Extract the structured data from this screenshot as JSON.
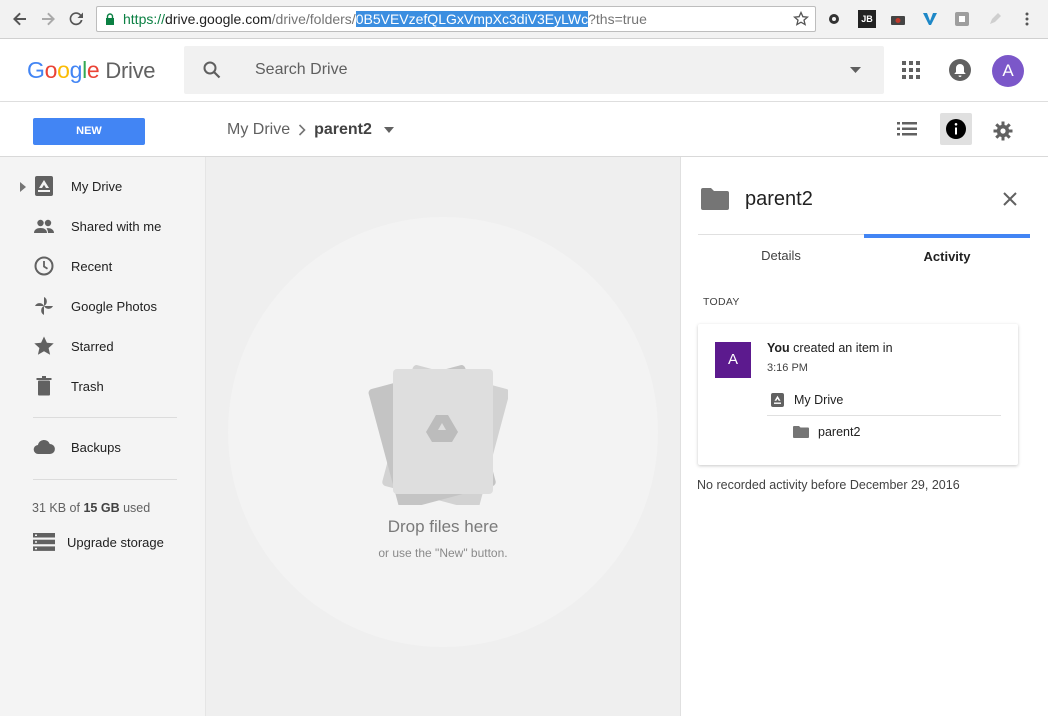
{
  "browser": {
    "url_scheme": "https://",
    "url_host": "drive.google.com",
    "url_path": "/drive/folders/",
    "url_selected": "0B5VEVzefQLGxVmpXc3diV3EyLWc",
    "url_query": "?ths=true"
  },
  "header": {
    "logo_google": "Google",
    "logo_drive": "Drive",
    "search_placeholder": "Search Drive",
    "avatar_letter": "A"
  },
  "toolbar": {
    "new_label": "NEW",
    "breadcrumb_root": "My Drive",
    "breadcrumb_current": "parent2"
  },
  "sidebar": {
    "items": [
      {
        "label": "My Drive",
        "icon": "drive-icon"
      },
      {
        "label": "Shared with me",
        "icon": "people-icon"
      },
      {
        "label": "Recent",
        "icon": "clock-icon"
      },
      {
        "label": "Google Photos",
        "icon": "pinwheel-icon"
      },
      {
        "label": "Starred",
        "icon": "star-icon"
      },
      {
        "label": "Trash",
        "icon": "trash-icon"
      }
    ],
    "backups_label": "Backups",
    "storage_used": "31 KB",
    "storage_of": "of",
    "storage_total": "15 GB",
    "storage_suffix": "used",
    "upgrade_label": "Upgrade storage"
  },
  "main": {
    "drop_title": "Drop files here",
    "drop_subtitle": "or use the \"New\" button."
  },
  "details": {
    "title": "parent2",
    "tabs": [
      "Details",
      "Activity"
    ],
    "active_tab": "Activity",
    "today_label": "TODAY",
    "activity": {
      "avatar_letter": "A",
      "actor": "You",
      "action": "created an item in",
      "time": "3:16 PM",
      "location": "My Drive",
      "item": "parent2"
    },
    "no_activity_text": "No recorded activity before December 29, 2016"
  },
  "colors": {
    "accent": "#4285f4",
    "avatar": "#7b57c9",
    "activity_avatar": "#5c1a8e"
  }
}
